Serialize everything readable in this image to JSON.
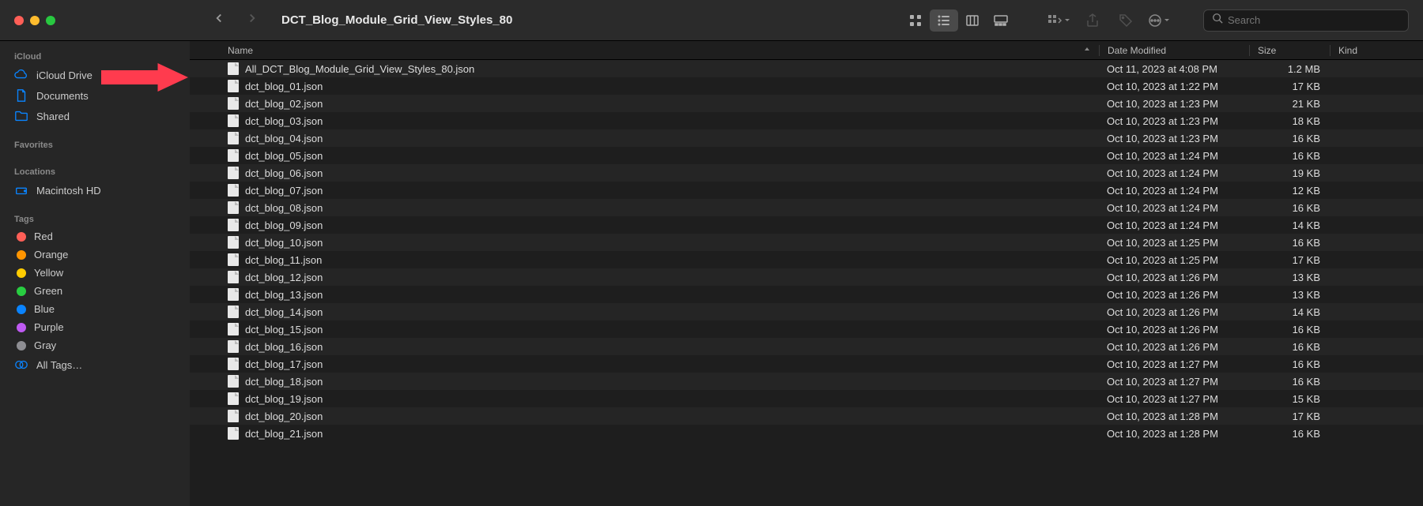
{
  "window": {
    "title": "DCT_Blog_Module_Grid_View_Styles_80"
  },
  "search": {
    "placeholder": "Search"
  },
  "sidebar": {
    "sections": [
      {
        "heading": "iCloud",
        "items": [
          {
            "label": "iCloud Drive",
            "icon": "cloud",
            "eject": true
          },
          {
            "label": "Documents",
            "icon": "doc"
          },
          {
            "label": "Shared",
            "icon": "folder-shared"
          }
        ]
      },
      {
        "heading": "Favorites",
        "items": []
      },
      {
        "heading": "Locations",
        "items": [
          {
            "label": "Macintosh HD",
            "icon": "hdd"
          }
        ]
      },
      {
        "heading": "Tags",
        "items": [
          {
            "label": "Red",
            "icon": "tag",
            "color": "#ff5f57"
          },
          {
            "label": "Orange",
            "icon": "tag",
            "color": "#ff9500"
          },
          {
            "label": "Yellow",
            "icon": "tag",
            "color": "#ffcc00"
          },
          {
            "label": "Green",
            "icon": "tag",
            "color": "#28cd41"
          },
          {
            "label": "Blue",
            "icon": "tag",
            "color": "#0a84ff"
          },
          {
            "label": "Purple",
            "icon": "tag",
            "color": "#bf5af2"
          },
          {
            "label": "Gray",
            "icon": "tag",
            "color": "#8e8e93"
          },
          {
            "label": "All Tags…",
            "icon": "alltags"
          }
        ]
      }
    ]
  },
  "columns": {
    "name": "Name",
    "date": "Date Modified",
    "size": "Size",
    "kind": "Kind"
  },
  "files": [
    {
      "name": "All_DCT_Blog_Module_Grid_View_Styles_80.json",
      "date": "Oct 11, 2023 at 4:08 PM",
      "size": "1.2 MB"
    },
    {
      "name": "dct_blog_01.json",
      "date": "Oct 10, 2023 at 1:22 PM",
      "size": "17 KB"
    },
    {
      "name": "dct_blog_02.json",
      "date": "Oct 10, 2023 at 1:23 PM",
      "size": "21 KB"
    },
    {
      "name": "dct_blog_03.json",
      "date": "Oct 10, 2023 at 1:23 PM",
      "size": "18 KB"
    },
    {
      "name": "dct_blog_04.json",
      "date": "Oct 10, 2023 at 1:23 PM",
      "size": "16 KB"
    },
    {
      "name": "dct_blog_05.json",
      "date": "Oct 10, 2023 at 1:24 PM",
      "size": "16 KB"
    },
    {
      "name": "dct_blog_06.json",
      "date": "Oct 10, 2023 at 1:24 PM",
      "size": "19 KB"
    },
    {
      "name": "dct_blog_07.json",
      "date": "Oct 10, 2023 at 1:24 PM",
      "size": "12 KB"
    },
    {
      "name": "dct_blog_08.json",
      "date": "Oct 10, 2023 at 1:24 PM",
      "size": "16 KB"
    },
    {
      "name": "dct_blog_09.json",
      "date": "Oct 10, 2023 at 1:24 PM",
      "size": "14 KB"
    },
    {
      "name": "dct_blog_10.json",
      "date": "Oct 10, 2023 at 1:25 PM",
      "size": "16 KB"
    },
    {
      "name": "dct_blog_11.json",
      "date": "Oct 10, 2023 at 1:25 PM",
      "size": "17 KB"
    },
    {
      "name": "dct_blog_12.json",
      "date": "Oct 10, 2023 at 1:26 PM",
      "size": "13 KB"
    },
    {
      "name": "dct_blog_13.json",
      "date": "Oct 10, 2023 at 1:26 PM",
      "size": "13 KB"
    },
    {
      "name": "dct_blog_14.json",
      "date": "Oct 10, 2023 at 1:26 PM",
      "size": "14 KB"
    },
    {
      "name": "dct_blog_15.json",
      "date": "Oct 10, 2023 at 1:26 PM",
      "size": "16 KB"
    },
    {
      "name": "dct_blog_16.json",
      "date": "Oct 10, 2023 at 1:26 PM",
      "size": "16 KB"
    },
    {
      "name": "dct_blog_17.json",
      "date": "Oct 10, 2023 at 1:27 PM",
      "size": "16 KB"
    },
    {
      "name": "dct_blog_18.json",
      "date": "Oct 10, 2023 at 1:27 PM",
      "size": "16 KB"
    },
    {
      "name": "dct_blog_19.json",
      "date": "Oct 10, 2023 at 1:27 PM",
      "size": "15 KB"
    },
    {
      "name": "dct_blog_20.json",
      "date": "Oct 10, 2023 at 1:28 PM",
      "size": "17 KB"
    },
    {
      "name": "dct_blog_21.json",
      "date": "Oct 10, 2023 at 1:28 PM",
      "size": "16 KB"
    }
  ]
}
